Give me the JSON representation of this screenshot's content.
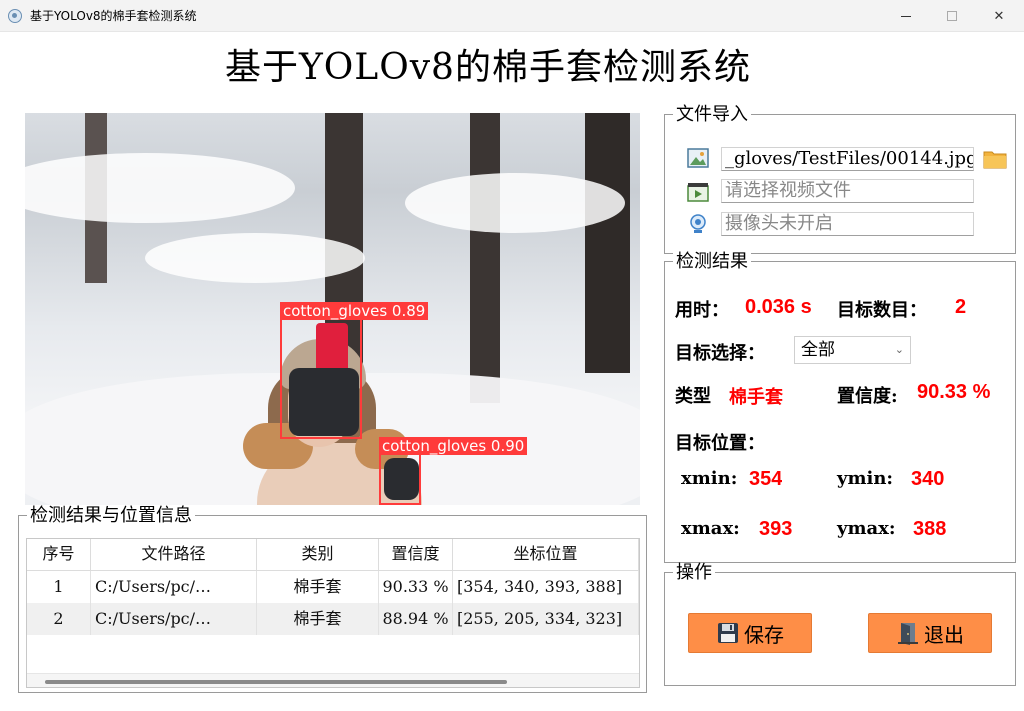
{
  "window": {
    "title": "基于YOLOv8的棉手套检测系统"
  },
  "app": {
    "title": "基于YOLOv8的棉手套检测系统"
  },
  "detections_overlay": [
    {
      "label": "cotton_gloves 0.89"
    },
    {
      "label": "cotton_gloves 0.90"
    }
  ],
  "file_import": {
    "title": "文件导入",
    "image_path": "_gloves/TestFiles/00144.jpg",
    "video_placeholder": "请选择视频文件",
    "camera_placeholder": "摄像头未开启",
    "icons": [
      "image-icon",
      "video-icon",
      "camera-icon",
      "folder-icon"
    ]
  },
  "results": {
    "title": "检测结果",
    "time_label": "用时：",
    "time_value": "0.036 s",
    "count_label": "目标数目：",
    "count_value": "2",
    "select_label": "目标选择：",
    "select_value": "全部",
    "type_label": "类型",
    "type_value": "棉手套",
    "conf_label": "置信度:",
    "conf_value": "90.33 %",
    "position_label": "目标位置：",
    "xmin_label": "xmin:",
    "xmin_value": "354",
    "ymin_label": "ymin:",
    "ymin_value": "340",
    "xmax_label": "xmax:",
    "xmax_value": "393",
    "ymax_label": "ymax:",
    "ymax_value": "388"
  },
  "operations": {
    "title": "操作",
    "save_label": "保存",
    "exit_label": "退出"
  },
  "table": {
    "title": "检测结果与位置信息",
    "headers": [
      "序号",
      "文件路径",
      "类别",
      "置信度",
      "坐标位置"
    ],
    "rows": [
      [
        "1",
        "C:/Users/pc/…",
        "棉手套",
        "90.33 %",
        "[354, 340, 393, 388]"
      ],
      [
        "2",
        "C:/Users/pc/…",
        "棉手套",
        "88.94 %",
        "[255, 205, 334, 323]"
      ]
    ]
  },
  "colors": {
    "accent_button": "#fe8e47",
    "result_red": "#ff0000",
    "bbox_red": "#ff3b3b"
  }
}
